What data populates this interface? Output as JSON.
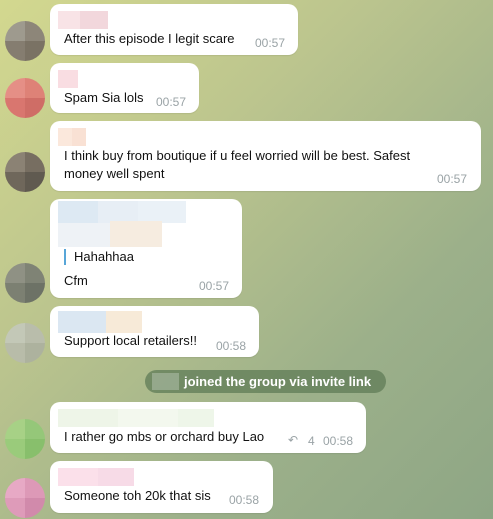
{
  "messages": [
    {
      "text": "After this episode I legit scare",
      "time": "00:57"
    },
    {
      "text": "Spam Sia lols",
      "time": "00:57"
    },
    {
      "text": "I think buy from boutique if u feel worried will be best. Safest money well spent",
      "time": "00:57"
    },
    {
      "quote": "Hahahhaa",
      "text": "Cfm",
      "time": "00:57"
    },
    {
      "text": "Support local retailers!!",
      "time": "00:58"
    },
    {
      "text": "I rather go mbs or orchard buy Lao",
      "replies": "4",
      "time": "00:58"
    },
    {
      "text": "Someone toh 20k that sis",
      "time": "00:58"
    }
  ],
  "service_message": "joined the group via invite link",
  "icons": {
    "reply": "reply-arrow-icon"
  },
  "colors": {
    "quote_bar": "#58a6d8",
    "time_text": "#9aa3a6",
    "service_bg": "#627d58"
  }
}
